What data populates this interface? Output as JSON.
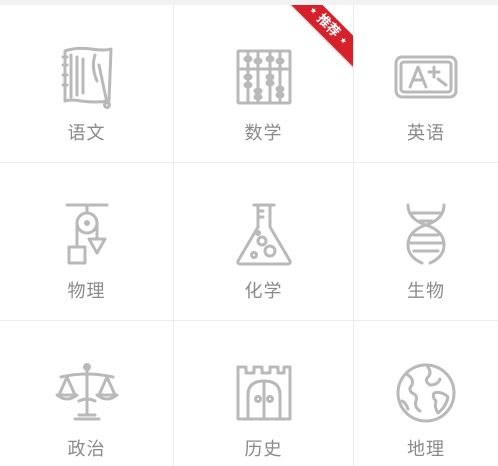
{
  "badge": {
    "recommend": "推荐"
  },
  "subjects": [
    {
      "label": "语文",
      "icon": "scroll-icon"
    },
    {
      "label": "数学",
      "icon": "abacus-icon"
    },
    {
      "label": "英语",
      "icon": "chalkboard-icon"
    },
    {
      "label": "物理",
      "icon": "pulley-icon"
    },
    {
      "label": "化学",
      "icon": "flask-icon"
    },
    {
      "label": "生物",
      "icon": "dna-icon"
    },
    {
      "label": "政治",
      "icon": "scales-icon"
    },
    {
      "label": "历史",
      "icon": "castle-gate-icon"
    },
    {
      "label": "地理",
      "icon": "globe-icon"
    }
  ]
}
